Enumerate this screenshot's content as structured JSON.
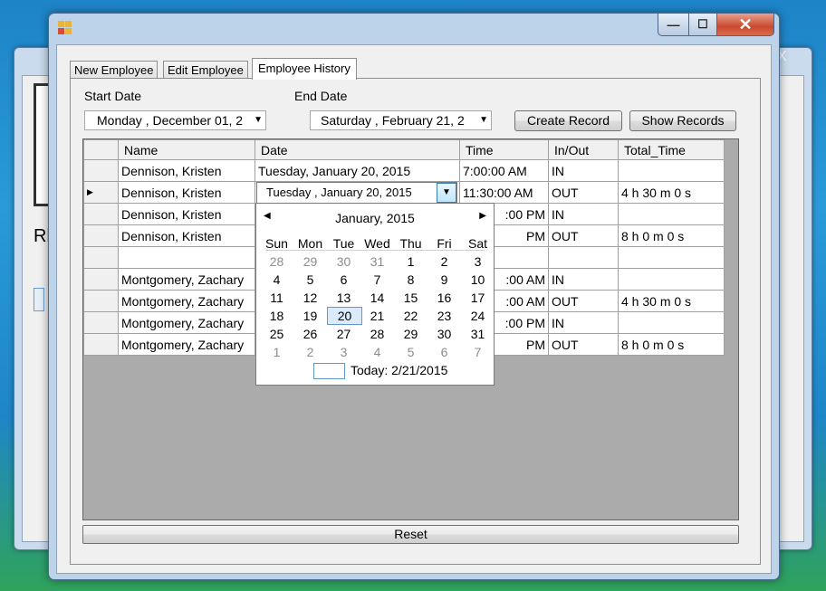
{
  "background_window": {
    "partial_label": "Rl",
    "close_glyph": "X"
  },
  "window": {
    "controls": {
      "minimize": "—",
      "maximize": "☐",
      "close": "✕"
    }
  },
  "tabs": [
    {
      "label": "New Employee"
    },
    {
      "label": "Edit Employee"
    },
    {
      "label": "Employee History"
    }
  ],
  "filters": {
    "start_label": "Start Date",
    "start_value": "Monday   , December 01, 2",
    "end_label": "End Date",
    "end_value": "Saturday  ,  February  21, 2"
  },
  "buttons": {
    "create": "Create Record",
    "show": "Show Records",
    "reset": "Reset"
  },
  "grid": {
    "columns": [
      "Name",
      "Date",
      "Time",
      "In/Out",
      "Total_Time"
    ],
    "current_row_marker": "▶",
    "rows": [
      {
        "name": "Dennison, Kristen",
        "date": "Tuesday, January 20, 2015",
        "time": "7:00:00 AM",
        "inout": "IN",
        "total": ""
      },
      {
        "name": "Dennison, Kristen",
        "date": "",
        "time": "11:30:00 AM",
        "inout": "OUT",
        "total": "4 h 30 m 0 s"
      },
      {
        "name": "Dennison, Kristen",
        "date": "",
        "time": ":00 PM",
        "inout": "IN",
        "total": ""
      },
      {
        "name": "Dennison, Kristen",
        "date": "",
        "time": "PM",
        "inout": "OUT",
        "total": "8 h 0 m 0 s"
      },
      {
        "name": "",
        "date": "",
        "time": "",
        "inout": "",
        "total": ""
      },
      {
        "name": "Montgomery, Zachary",
        "date": "",
        "time": ":00 AM",
        "inout": "IN",
        "total": ""
      },
      {
        "name": "Montgomery, Zachary",
        "date": "",
        "time": ":00 AM",
        "inout": "OUT",
        "total": "4 h 30 m 0 s"
      },
      {
        "name": "Montgomery, Zachary",
        "date": "",
        "time": ":00 PM",
        "inout": "IN",
        "total": ""
      },
      {
        "name": "Montgomery, Zachary",
        "date": "",
        "time": "PM",
        "inout": "OUT",
        "total": "8 h 0 m 0 s"
      }
    ],
    "editor_value": "Tuesday  ,   January   20, 2015"
  },
  "calendar": {
    "month_title": "January, 2015",
    "prev": "◀",
    "next": "▶",
    "weekdays": [
      "Sun",
      "Mon",
      "Tue",
      "Wed",
      "Thu",
      "Fri",
      "Sat"
    ],
    "weeks": [
      [
        [
          "28",
          1
        ],
        [
          "29",
          1
        ],
        [
          "30",
          1
        ],
        [
          "31",
          1
        ],
        [
          "1",
          0
        ],
        [
          "2",
          0
        ],
        [
          "3",
          0
        ]
      ],
      [
        [
          "4",
          0
        ],
        [
          "5",
          0
        ],
        [
          "6",
          0
        ],
        [
          "7",
          0
        ],
        [
          "8",
          0
        ],
        [
          "9",
          0
        ],
        [
          "10",
          0
        ]
      ],
      [
        [
          "11",
          0
        ],
        [
          "12",
          0
        ],
        [
          "13",
          0
        ],
        [
          "14",
          0
        ],
        [
          "15",
          0
        ],
        [
          "16",
          0
        ],
        [
          "17",
          0
        ]
      ],
      [
        [
          "18",
          0
        ],
        [
          "19",
          0
        ],
        [
          "20",
          0
        ],
        [
          "21",
          0
        ],
        [
          "22",
          0
        ],
        [
          "23",
          0
        ],
        [
          "24",
          0
        ]
      ],
      [
        [
          "25",
          0
        ],
        [
          "26",
          0
        ],
        [
          "27",
          0
        ],
        [
          "28",
          0
        ],
        [
          "29",
          0
        ],
        [
          "30",
          0
        ],
        [
          "31",
          0
        ]
      ],
      [
        [
          "1",
          1
        ],
        [
          "2",
          1
        ],
        [
          "3",
          1
        ],
        [
          "4",
          1
        ],
        [
          "5",
          1
        ],
        [
          "6",
          1
        ],
        [
          "7",
          1
        ]
      ]
    ],
    "selected_day": "20",
    "today_label": "Today: 2/21/2015"
  }
}
